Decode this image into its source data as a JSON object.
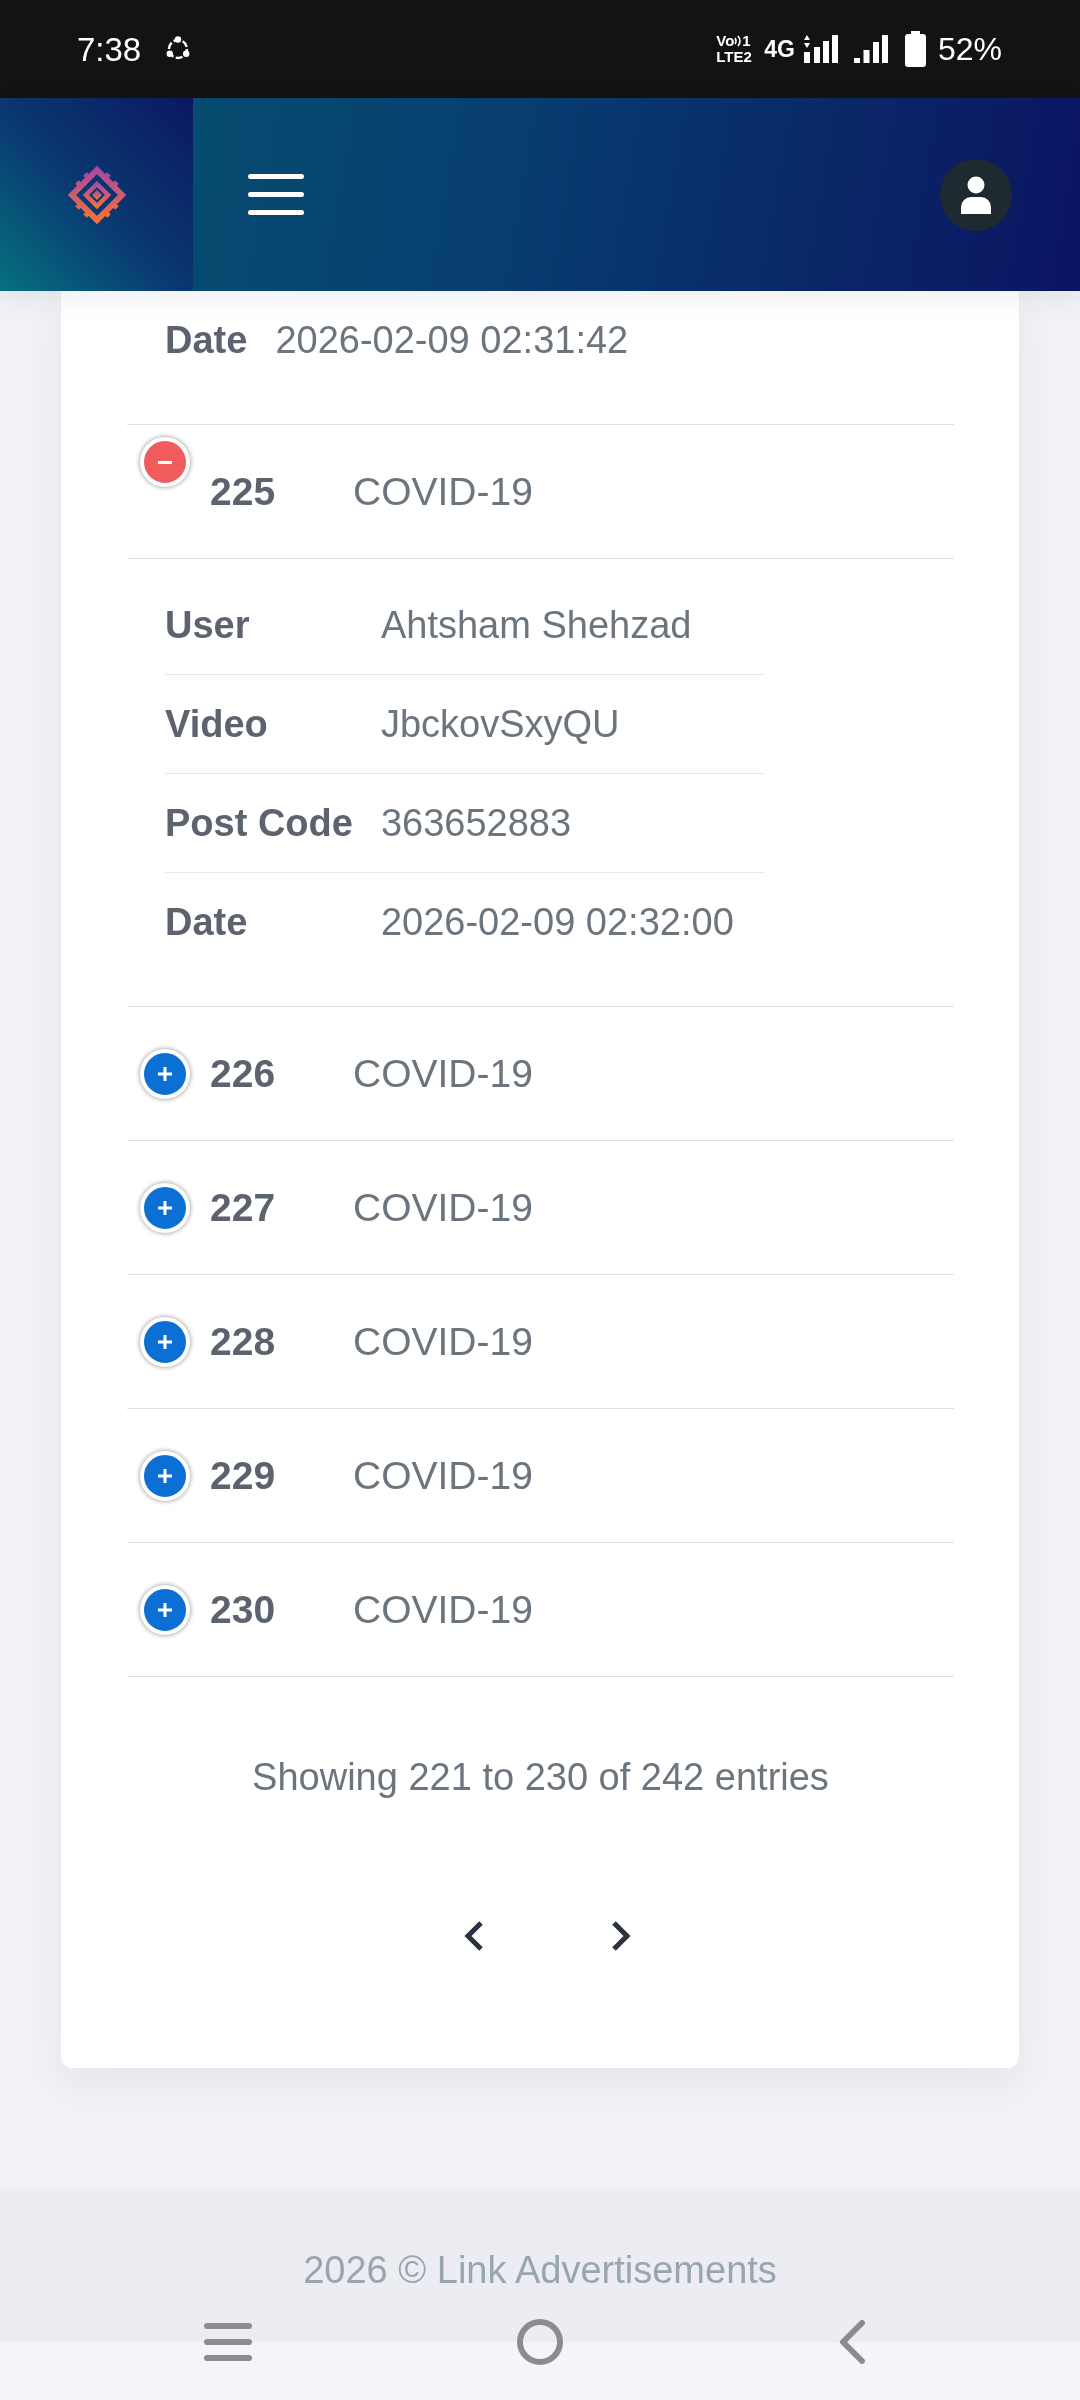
{
  "status_bar": {
    "time": "7:38",
    "volte": {
      "voice": "Vo",
      "sim": "1",
      "network": "LTE2"
    },
    "network_type": "4G",
    "battery": "52%"
  },
  "table": {
    "rows": [
      {
        "expanded": true,
        "details": [
          {
            "label": "Date",
            "value": "2026-02-09 02:31:42"
          }
        ]
      },
      {
        "id": "225",
        "name": "COVID-19",
        "expanded": true,
        "details": [
          {
            "label": "User",
            "value": "Ahtsham Shehzad"
          },
          {
            "label": "Video",
            "value": "JbckovSxyQU"
          },
          {
            "label": "Post Code",
            "value": "363652883"
          },
          {
            "label": "Date",
            "value": "2026-02-09 02:32:00"
          }
        ]
      },
      {
        "id": "226",
        "name": "COVID-19",
        "expanded": false
      },
      {
        "id": "227",
        "name": "COVID-19",
        "expanded": false
      },
      {
        "id": "228",
        "name": "COVID-19",
        "expanded": false
      },
      {
        "id": "229",
        "name": "COVID-19",
        "expanded": false
      },
      {
        "id": "230",
        "name": "COVID-19",
        "expanded": false
      }
    ]
  },
  "info": "Showing 221 to 230 of 242 entries",
  "footer": "2026 © Link Advertisements"
}
